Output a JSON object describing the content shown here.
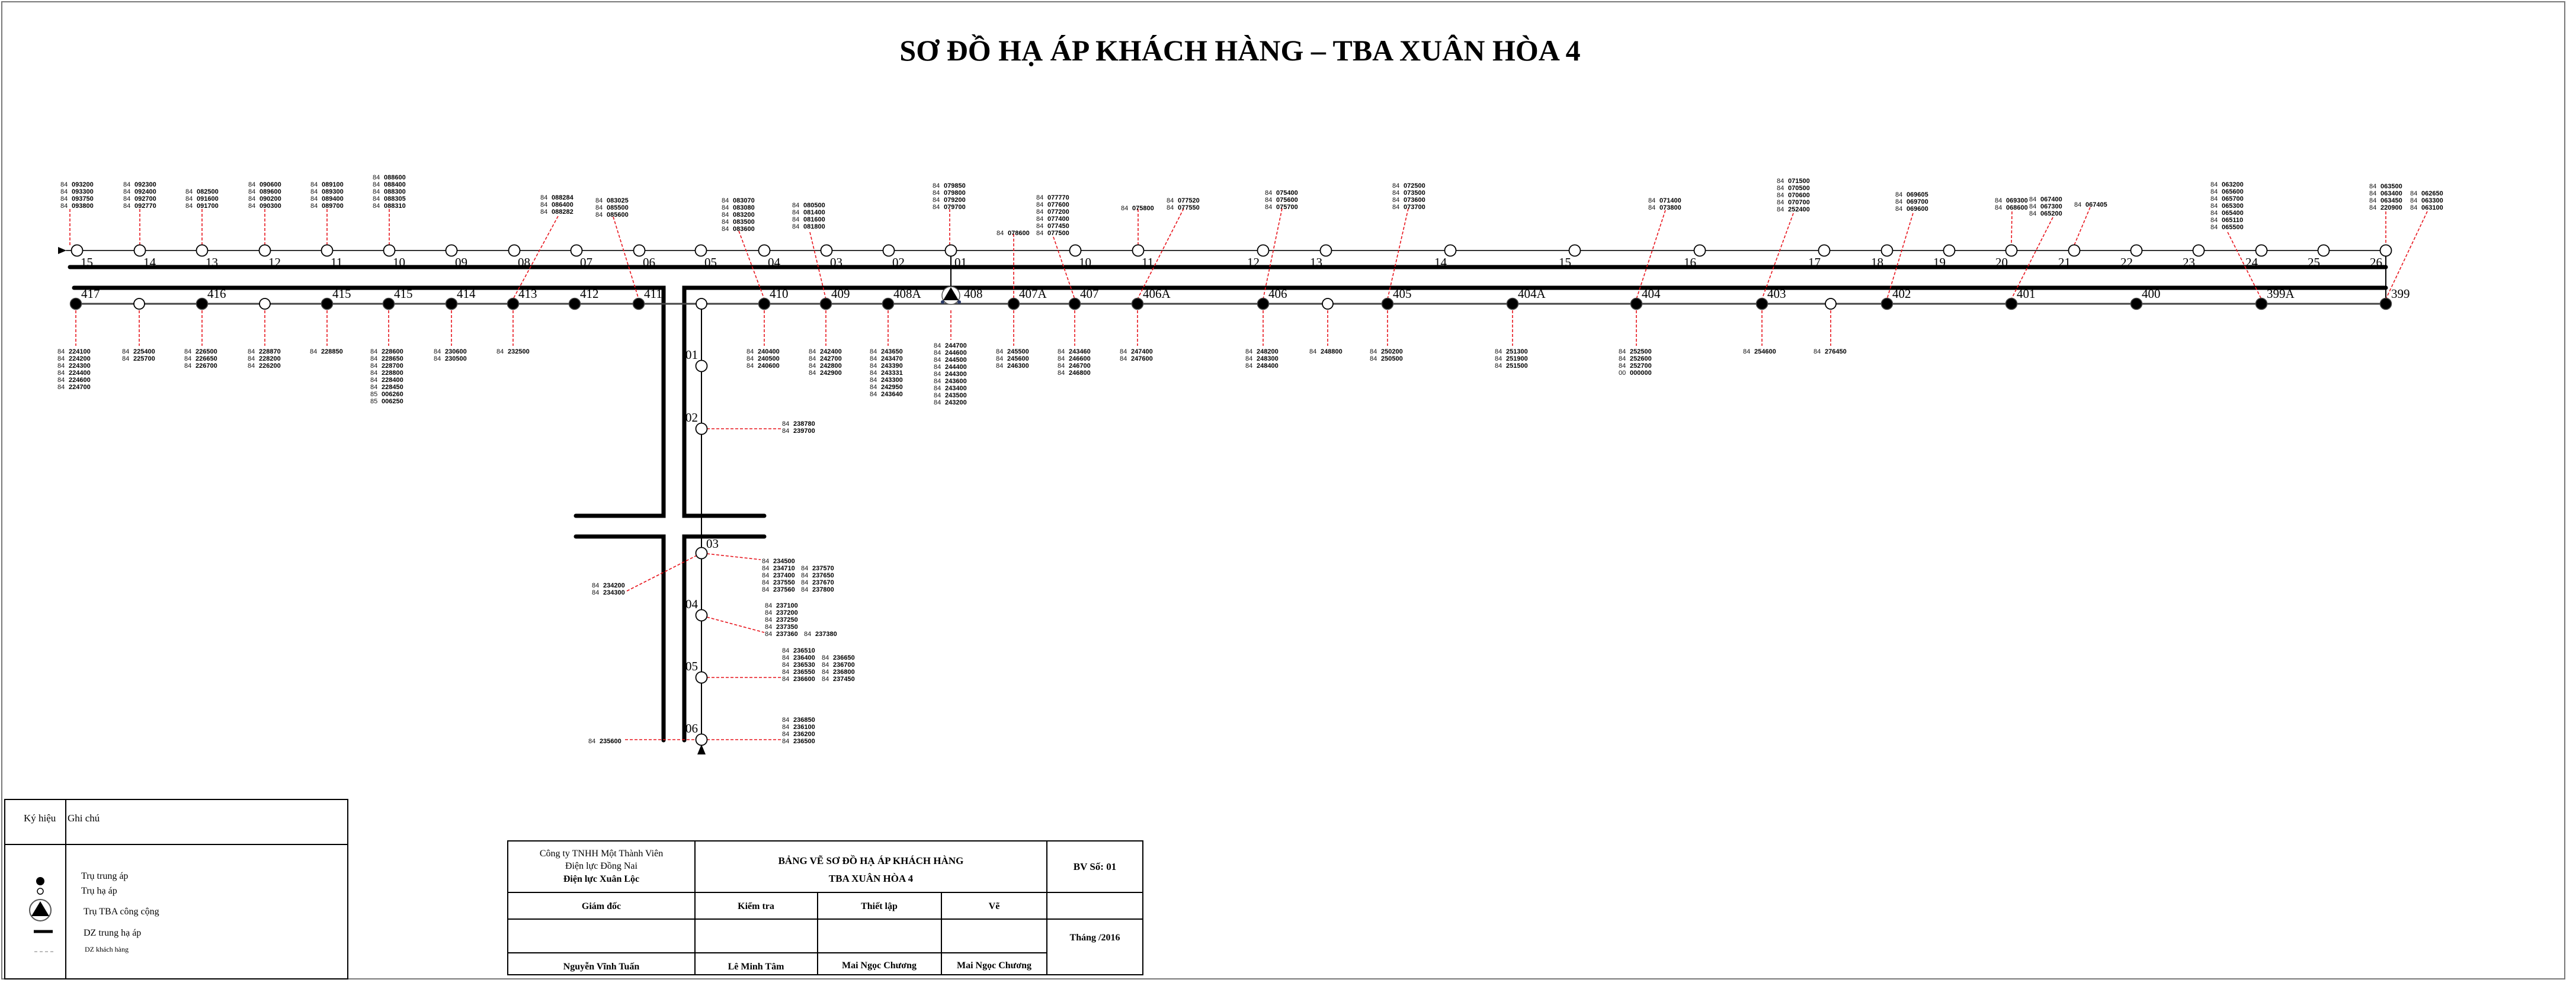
{
  "title": "SƠ ĐỒ HẠ ÁP KHÁCH HÀNG – TBA XUÂN HÒA 4",
  "colors": {
    "customer_line": "#e8141c",
    "line": "#000000",
    "tba_dot": "#2b3a67"
  },
  "top_poles": [
    "15",
    "14",
    "13",
    "12",
    "11",
    "10",
    "09",
    "08",
    "07",
    "06",
    "05",
    "04",
    "03",
    "02",
    "01",
    "10",
    "11",
    "12",
    "13",
    "14",
    "15",
    "16",
    "17",
    "18",
    "19",
    "20",
    "21",
    "22",
    "23",
    "24",
    "25",
    "26"
  ],
  "bottom_poles": [
    {
      "label": "417",
      "type": "trung_ap"
    },
    {
      "label": "",
      "type": "ha_ap"
    },
    {
      "label": "416",
      "type": "trung_ap"
    },
    {
      "label": "",
      "type": "ha_ap"
    },
    {
      "label": "415",
      "type": "trung_ap"
    },
    {
      "label": "415",
      "type": "trung_ap"
    },
    {
      "label": "414",
      "type": "trung_ap"
    },
    {
      "label": "413",
      "type": "trung_ap"
    },
    {
      "label": "412",
      "type": "trung_ap"
    },
    {
      "label": "411",
      "type": "trung_ap"
    },
    {
      "label": "",
      "type": "ha_ap"
    },
    {
      "label": "410",
      "type": "trung_ap"
    },
    {
      "label": "409",
      "type": "trung_ap"
    },
    {
      "label": "408A",
      "type": "trung_ap"
    },
    {
      "label": "408",
      "type": "tba"
    },
    {
      "label": "407A",
      "type": "trung_ap"
    },
    {
      "label": "407",
      "type": "trung_ap"
    },
    {
      "label": "406A",
      "type": "trung_ap"
    },
    {
      "label": "406",
      "type": "trung_ap"
    },
    {
      "label": "",
      "type": "ha_ap"
    },
    {
      "label": "405",
      "type": "trung_ap"
    },
    {
      "label": "404A",
      "type": "trung_ap"
    },
    {
      "label": "404",
      "type": "trung_ap"
    },
    {
      "label": "403",
      "type": "trung_ap"
    },
    {
      "label": "",
      "type": "ha_ap"
    },
    {
      "label": "402",
      "type": "trung_ap"
    },
    {
      "label": "401",
      "type": "trung_ap"
    },
    {
      "label": "400",
      "type": "trung_ap"
    },
    {
      "label": "399A",
      "type": "trung_ap"
    },
    {
      "label": "399",
      "type": "trung_ap"
    }
  ],
  "branch_poles": [
    "01",
    "02",
    "03",
    "04",
    "05",
    "06"
  ],
  "customers": {
    "top": [
      {
        "pole": "15",
        "codes": [
          "84 093200",
          "84 093300",
          "84 093750",
          "84 093800"
        ]
      },
      {
        "pole": "14",
        "codes": [
          "84 092300",
          "84 092400",
          "84 092700",
          "84 092770"
        ]
      },
      {
        "pole": "13",
        "codes": [
          "84 082500",
          "84 091600",
          "84 091700"
        ]
      },
      {
        "pole": "12",
        "codes": [
          "84 090600",
          "84 089600",
          "84 090200",
          "84 090300"
        ]
      },
      {
        "pole": "11",
        "codes": [
          "84 089100",
          "84 089300",
          "84 089400",
          "84 089700"
        ]
      },
      {
        "pole": "10",
        "codes": [
          "84 088600",
          "84 088400",
          "84 088300",
          "84 088305",
          "84 088310"
        ]
      },
      {
        "pole": "413",
        "codes": [
          "84 088284",
          "84 086400",
          "84 088282"
        ]
      },
      {
        "pole": "411",
        "codes": [
          "84 083025",
          "84 085500",
          "84 085600"
        ]
      },
      {
        "pole": "410",
        "codes": [
          "84 083070",
          "84 083080",
          "84 083200",
          "84 083500",
          "84 083600"
        ]
      },
      {
        "pole": "409",
        "codes": [
          "84 080500",
          "84 081400",
          "84 081600",
          "84 081800"
        ]
      },
      {
        "pole": "01",
        "codes": [
          "84 079850",
          "84 079800",
          "84 079200",
          "84 079700"
        ]
      },
      {
        "pole": "407A",
        "codes": [
          "84 078600"
        ]
      },
      {
        "pole": "407",
        "codes": [
          "84 077770",
          "84 077600",
          "84 077200",
          "84 077400",
          "84 077450",
          "84 077500"
        ]
      },
      {
        "pole": "11",
        "codes": [
          "84 075800"
        ]
      },
      {
        "pole": "406A",
        "codes": [
          "84 077520",
          "84 077550"
        ]
      },
      {
        "pole": "406",
        "codes": [
          "84 075400",
          "84 075600",
          "84 075700"
        ]
      },
      {
        "pole": "405",
        "codes": [
          "84 072500",
          "84 073500",
          "84 073600",
          "84 073700"
        ]
      },
      {
        "pole": "404",
        "codes": [
          "84 071400",
          "84 073800"
        ]
      },
      {
        "pole": "403",
        "codes": [
          "84 071500",
          "84 070500",
          "84 070600",
          "84 070700",
          "84 252400"
        ]
      },
      {
        "pole": "402",
        "codes": [
          "84 069605",
          "84 069700",
          "84 069600"
        ]
      },
      {
        "pole": "20",
        "codes": [
          "84 069300",
          "84 068600"
        ]
      },
      {
        "pole": "401",
        "codes": [
          "84 067400",
          "84 067300",
          "84 065200"
        ]
      },
      {
        "pole": "21",
        "codes": [
          "84 067405"
        ]
      },
      {
        "pole": "399A",
        "codes": [
          "84 063200",
          "84 065600",
          "84 065700",
          "84 065300",
          "84 065400",
          "84 065110",
          "84 065500"
        ]
      },
      {
        "pole": "26",
        "codes": [
          "84 063500",
          "84 063400",
          "84 063450",
          "84 220900"
        ]
      },
      {
        "pole": "399",
        "codes": [
          "84 062650",
          "84 063300",
          "84 063100"
        ]
      }
    ],
    "bottom": [
      {
        "pole": "417",
        "codes": [
          "84 224100",
          "84 224200",
          "84 224300",
          "84 224400",
          "84 224600",
          "84 224700"
        ]
      },
      {
        "pole": "",
        "codes": [
          "84 225400",
          "84 225700"
        ]
      },
      {
        "pole": "416",
        "codes": [
          "84 226500",
          "84 226650",
          "84 226700"
        ]
      },
      {
        "pole": "",
        "codes": [
          "84 228870",
          "84 228200",
          "84 226200"
        ]
      },
      {
        "pole": "415",
        "codes": [
          "84 228850"
        ]
      },
      {
        "pole": "415",
        "codes": [
          "84 228600",
          "84 228650",
          "84 228700",
          "84 228800",
          "84 228400",
          "84 228450",
          "85 006260",
          "85 006250"
        ]
      },
      {
        "pole": "414",
        "codes": [
          "84 230600",
          "84 230500"
        ]
      },
      {
        "pole": "413",
        "codes": [
          "84 232500"
        ]
      },
      {
        "pole": "410",
        "codes": [
          "84 240400",
          "84 240500",
          "84 240600"
        ]
      },
      {
        "pole": "409",
        "codes": [
          "84 242400",
          "84 242700",
          "84 242800",
          "84 242900"
        ]
      },
      {
        "pole": "408A",
        "codes": [
          "84 243650",
          "84 243470",
          "84 243390",
          "84 243331",
          "84 243300",
          "84 242950",
          "84 243640"
        ]
      },
      {
        "pole": "408",
        "codes": [
          "84 244700",
          "84 244600",
          "84 244500",
          "84 244400",
          "84 244300",
          "84 243600",
          "84 243400",
          "84 243500",
          "84 243200"
        ]
      },
      {
        "pole": "407A",
        "codes": [
          "84 245500",
          "84 245600",
          "84 246300"
        ]
      },
      {
        "pole": "407",
        "codes": [
          "84 243460",
          "84 246600",
          "84 246700",
          "84 246800"
        ]
      },
      {
        "pole": "406A",
        "codes": [
          "84 247400",
          "84 247600"
        ]
      },
      {
        "pole": "406",
        "codes": [
          "84 248200",
          "84 248300",
          "84 248400"
        ]
      },
      {
        "pole": "",
        "codes": [
          "84 248800"
        ]
      },
      {
        "pole": "405",
        "codes": [
          "84 250200",
          "84 250500"
        ]
      },
      {
        "pole": "404A",
        "codes": [
          "84 251300",
          "84 251900",
          "84 251500"
        ]
      },
      {
        "pole": "404",
        "codes": [
          "84 252500",
          "84 252600",
          "84 252700",
          "00 000000"
        ]
      },
      {
        "pole": "403",
        "codes": [
          "84 254600"
        ]
      },
      {
        "pole": "",
        "codes": [
          "84 276450"
        ]
      }
    ],
    "branch": [
      {
        "pole": "02",
        "codes": [
          "84 238780",
          "84 239700"
        ]
      },
      {
        "pole": "03",
        "codes": [
          "84 234500",
          "84 234710",
          "84 237400",
          "84 237550",
          "84 237560"
        ]
      },
      {
        "pole": "03",
        "codes": [
          "84 237570",
          "84 237650",
          "84 237670",
          "84 237800"
        ]
      },
      {
        "pole": "03",
        "codes": [
          "84 234200",
          "84 234300"
        ]
      },
      {
        "pole": "04",
        "codes": [
          "84 237100",
          "84 237200",
          "84 237250",
          "84 237350",
          "84 237360"
        ]
      },
      {
        "pole": "04",
        "codes": [
          "84 237380"
        ]
      },
      {
        "pole": "05",
        "codes": [
          "84 236510",
          "84 236400",
          "84 236530",
          "84 236550",
          "84 236600"
        ]
      },
      {
        "pole": "05",
        "codes": [
          "84 236650",
          "84 236700",
          "84 236800",
          "84 237450"
        ]
      },
      {
        "pole": "06",
        "codes": [
          "84 236850",
          "84 236100",
          "84 236200",
          "84 236500"
        ]
      },
      {
        "pole": "06",
        "codes": [
          "84 235600"
        ]
      }
    ]
  },
  "legend": {
    "header_symbol": "Ký hiệu",
    "header_note": "Ghi chú",
    "items": [
      {
        "icon": "filled-dot",
        "label": "Trụ trung áp"
      },
      {
        "icon": "open-circle",
        "label": "Trụ hạ áp"
      },
      {
        "icon": "tba-triangle",
        "label": "Trụ TBA công cộng"
      },
      {
        "icon": "thick-line",
        "label": "DZ trung hạ áp"
      },
      {
        "icon": "dashed-line",
        "label": "DZ khách hàng"
      }
    ]
  },
  "title_block": {
    "company_line1": "Công ty TNHH Một Thành Viên",
    "company_line2": "Điện lực Đồng Nai",
    "company_line3": "Điện lực Xuân Lộc",
    "drawing_title1": "BẢNG VẼ SƠ ĐỒ HẠ ÁP KHÁCH HÀNG",
    "drawing_title2": "TBA XUÂN HÒA 4",
    "drawing_no": "BV Số: 01",
    "role_director": "Giám đốc",
    "role_check": "Kiểm tra",
    "role_setup": "Thiết lập",
    "role_draw": "Vẽ",
    "date": "Tháng  /2016",
    "name_director": "Nguyễn Vĩnh Tuấn",
    "name_check": "Lê Minh Tâm",
    "name_setup": "Mai Ngọc Chương",
    "name_draw": "Mai Ngọc Chương"
  }
}
